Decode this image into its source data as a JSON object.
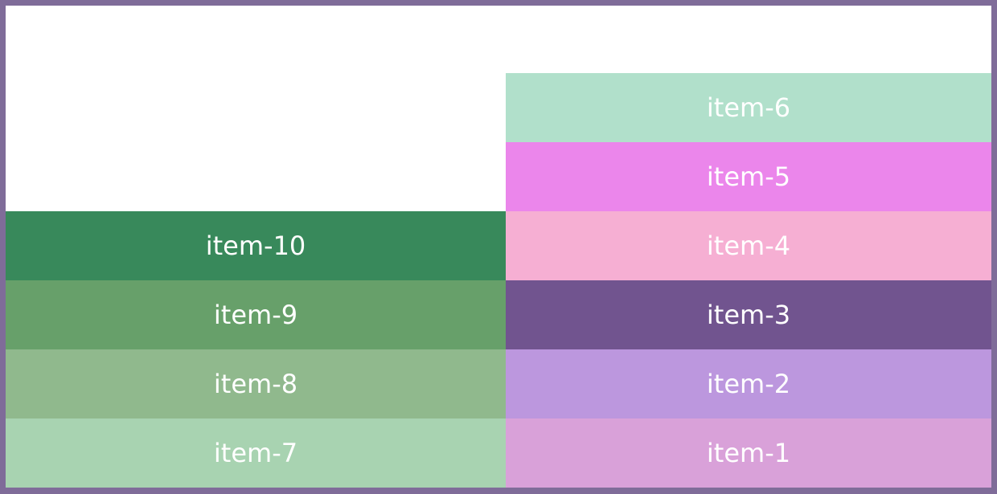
{
  "columns": [
    {
      "id": "left",
      "items": [
        {
          "label": "item-7",
          "color": "#a8d3b1"
        },
        {
          "label": "item-8",
          "color": "#90b98d"
        },
        {
          "label": "item-9",
          "color": "#67a06a"
        },
        {
          "label": "item-10",
          "color": "#38895b"
        }
      ]
    },
    {
      "id": "right",
      "items": [
        {
          "label": "item-1",
          "color": "#d9a1d9"
        },
        {
          "label": "item-2",
          "color": "#bc97de"
        },
        {
          "label": "item-3",
          "color": "#71548f"
        },
        {
          "label": "item-4",
          "color": "#f6afd3"
        },
        {
          "label": "item-5",
          "color": "#eb86eb"
        },
        {
          "label": "item-6",
          "color": "#b1e0cb"
        }
      ]
    }
  ]
}
